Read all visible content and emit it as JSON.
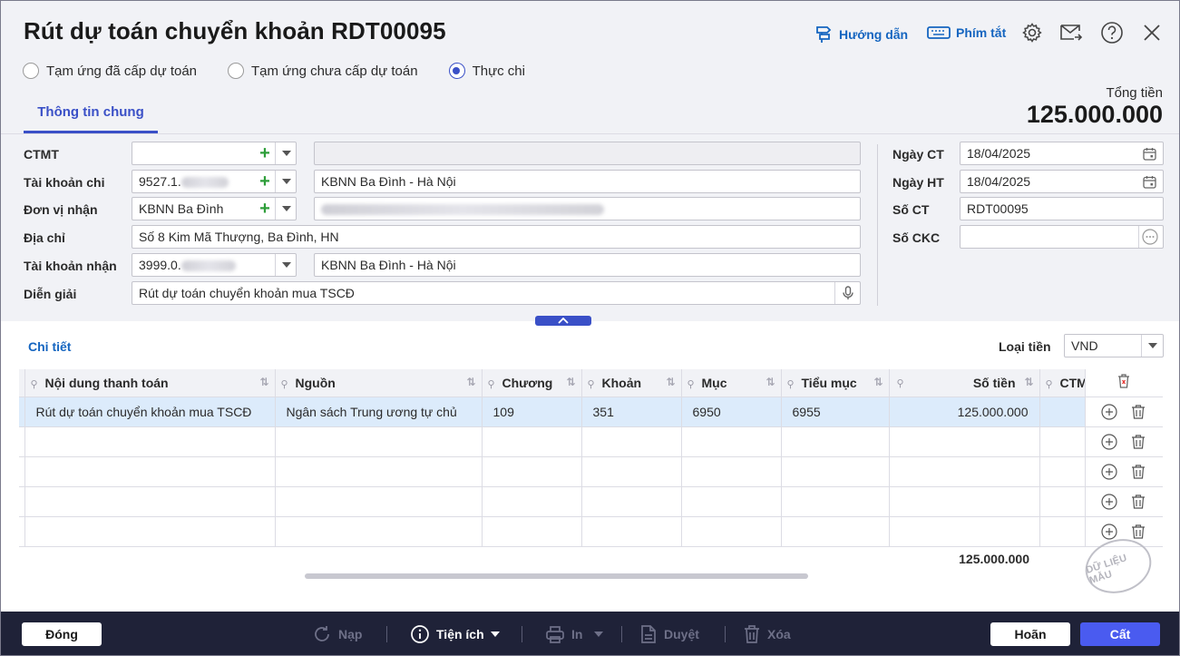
{
  "title": "Rút dự toán chuyển khoản RDT00095",
  "header": {
    "guide_label": "Hướng dẫn",
    "shortcut_label": "Phím tắt"
  },
  "radios": [
    {
      "label": "Tạm ứng đã cấp dự toán",
      "selected": false
    },
    {
      "label": "Tạm ứng chưa cấp dự toán",
      "selected": false
    },
    {
      "label": "Thực chi",
      "selected": true
    }
  ],
  "tab": "Thông tin chung",
  "total": {
    "label": "Tổng tiền",
    "value": "125.000.000"
  },
  "form": {
    "ctmt": {
      "label": "CTMT",
      "value": "",
      "desc": ""
    },
    "tk_chi": {
      "label": "Tài khoản chi",
      "value": "9527.1.",
      "desc": "KBNN Ba Đình - Hà Nội"
    },
    "don_vi_nhan": {
      "label": "Đơn vị nhận",
      "value": "KBNN Ba Đình"
    },
    "dia_chi": {
      "label": "Địa chỉ",
      "value": "Số 8 Kim Mã Thượng, Ba Đình, HN"
    },
    "tk_nhan": {
      "label": "Tài khoản nhận",
      "value": "3999.0.",
      "desc": "KBNN Ba Đình - Hà Nội"
    },
    "dien_giai": {
      "label": "Diễn giải",
      "value": "Rút dự toán chuyển khoản mua TSCĐ"
    },
    "ngay_ct": {
      "label": "Ngày CT",
      "value": "18/04/2025"
    },
    "ngay_ht": {
      "label": "Ngày HT",
      "value": "18/04/2025"
    },
    "so_ct": {
      "label": "Số CT",
      "value": "RDT00095"
    },
    "so_ckc": {
      "label": "Số CKC",
      "value": ""
    }
  },
  "detail": {
    "title": "Chi tiết",
    "currency_label": "Loại tiền",
    "currency": "VND",
    "columns": [
      "Nội dung thanh toán",
      "Nguồn",
      "Chương",
      "Khoản",
      "Mục",
      "Tiểu mục",
      "Số tiền",
      "CTM"
    ],
    "rows": [
      [
        "Rút dự toán chuyển khoản mua TSCĐ",
        "Ngân sách Trung ương tự chủ",
        "109",
        "351",
        "6950",
        "6955",
        "125.000.000",
        ""
      ],
      [
        "",
        "",
        "",
        "",
        "",
        "",
        "",
        ""
      ],
      [
        "",
        "",
        "",
        "",
        "",
        "",
        "",
        ""
      ],
      [
        "",
        "",
        "",
        "",
        "",
        "",
        "",
        ""
      ],
      [
        "",
        "",
        "",
        "",
        "",
        "",
        "",
        ""
      ]
    ],
    "footer_total": "125.000.000"
  },
  "watermark": "DỮ LIỆU MẪU",
  "footer": {
    "close": "Đóng",
    "reload": "Nạp",
    "utilities": "Tiện ích",
    "print": "In",
    "approve": "Duyệt",
    "delete": "Xóa",
    "cancel": "Hoãn",
    "save": "Cất"
  }
}
